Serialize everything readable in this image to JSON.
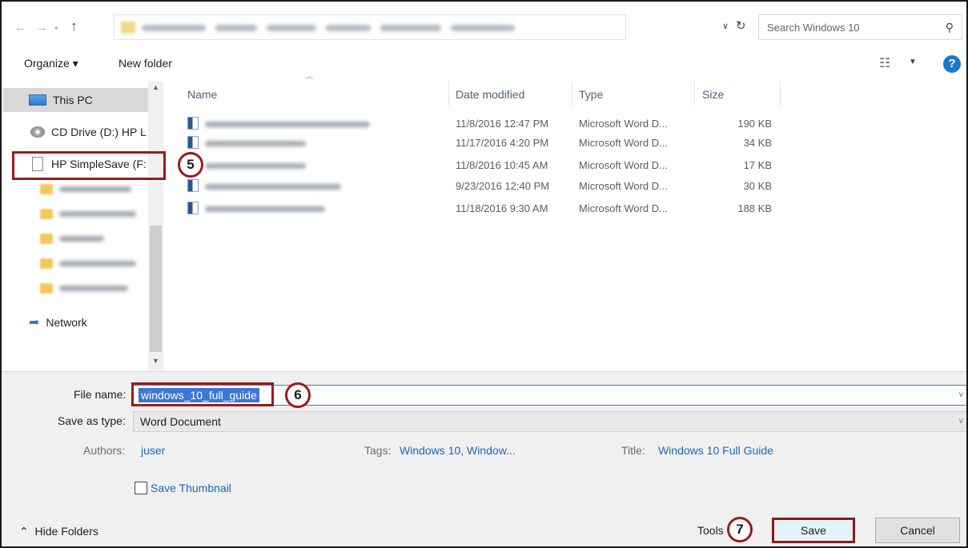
{
  "search": {
    "placeholder": "Search Windows 10"
  },
  "toolbar": {
    "organize_label": "Organize ▾",
    "new_folder_label": "New folder"
  },
  "nav": {
    "this_pc": "This PC",
    "cd_drive": "CD Drive (D:) HP L",
    "hp_simplesave": "HP SimpleSave (F:",
    "network": "Network"
  },
  "columns": {
    "name": "Name",
    "date": "Date modified",
    "type": "Type",
    "size": "Size"
  },
  "files": [
    {
      "date": "11/8/2016 12:47 PM",
      "type": "Microsoft Word D...",
      "size": "190 KB"
    },
    {
      "date": "11/17/2016 4:20 PM",
      "type": "Microsoft Word D...",
      "size": "34 KB"
    },
    {
      "date": "11/8/2016 10:45 AM",
      "type": "Microsoft Word D...",
      "size": "17 KB"
    },
    {
      "date": "9/23/2016 12:40 PM",
      "type": "Microsoft Word D...",
      "size": "30 KB"
    },
    {
      "date": "11/18/2016 9:30 AM",
      "type": "Microsoft Word D...",
      "size": "188 KB"
    }
  ],
  "form": {
    "file_name_label": "File name:",
    "file_name_value": "windows_10_full_guide",
    "save_type_label": "Save as type:",
    "save_type_value": "Word Document",
    "authors_label": "Authors:",
    "authors_value": "juser",
    "tags_label": "Tags:",
    "tags_value": "Windows 10, Window...",
    "title_label": "Title:",
    "title_value": "Windows 10 Full Guide",
    "save_thumbnail_label": "Save Thumbnail"
  },
  "footer": {
    "hide_folders_label": "Hide Folders",
    "tools_label": "Tools",
    "save_label": "Save",
    "cancel_label": "Cancel"
  },
  "callouts": {
    "step5": "5",
    "step6": "6",
    "step7": "7"
  },
  "colors": {
    "annotation": "#9b1b1b",
    "link": "#1c66c2",
    "selection": "#3a77d6"
  }
}
